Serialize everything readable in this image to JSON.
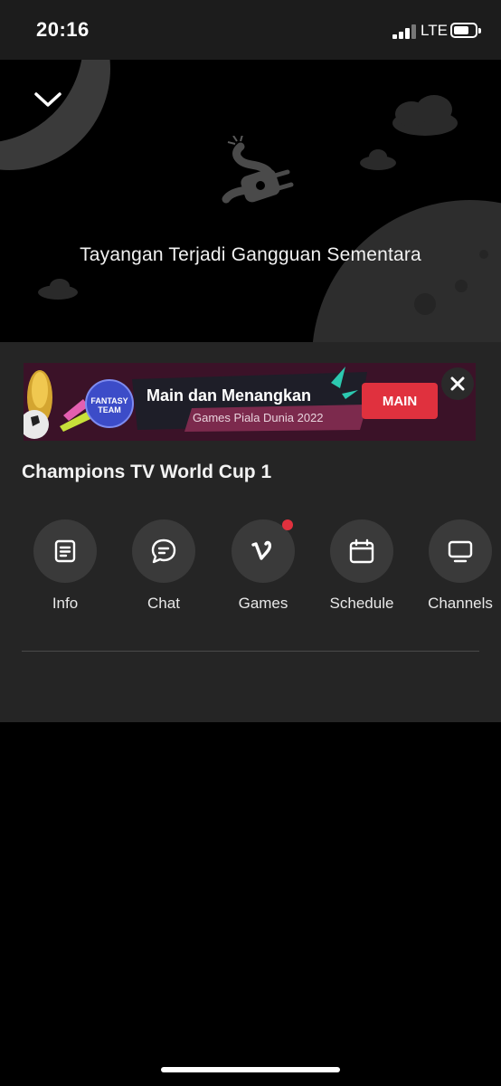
{
  "status_bar": {
    "time": "20:16",
    "network": "LTE"
  },
  "player": {
    "error_message": "Tayangan Terjadi Gangguan Sementara"
  },
  "banner": {
    "brand_line1": "FANTASY",
    "brand_line2": "TEAM",
    "title": "Main dan Menangkan",
    "subtitle": "Games Piala Dunia 2022",
    "cta": "MAIN"
  },
  "channel": {
    "title": "Champions TV World Cup 1"
  },
  "actions": [
    {
      "label": "Info",
      "icon": "document-icon"
    },
    {
      "label": "Chat",
      "icon": "chat-bubble-icon"
    },
    {
      "label": "Games",
      "icon": "games-v-icon",
      "notification": true
    },
    {
      "label": "Schedule",
      "icon": "calendar-icon"
    },
    {
      "label": "Channels",
      "icon": "tv-icon"
    }
  ],
  "colors": {
    "accent_red": "#e0313e",
    "panel_bg": "#252525",
    "banner_bg": "#3b1228"
  }
}
